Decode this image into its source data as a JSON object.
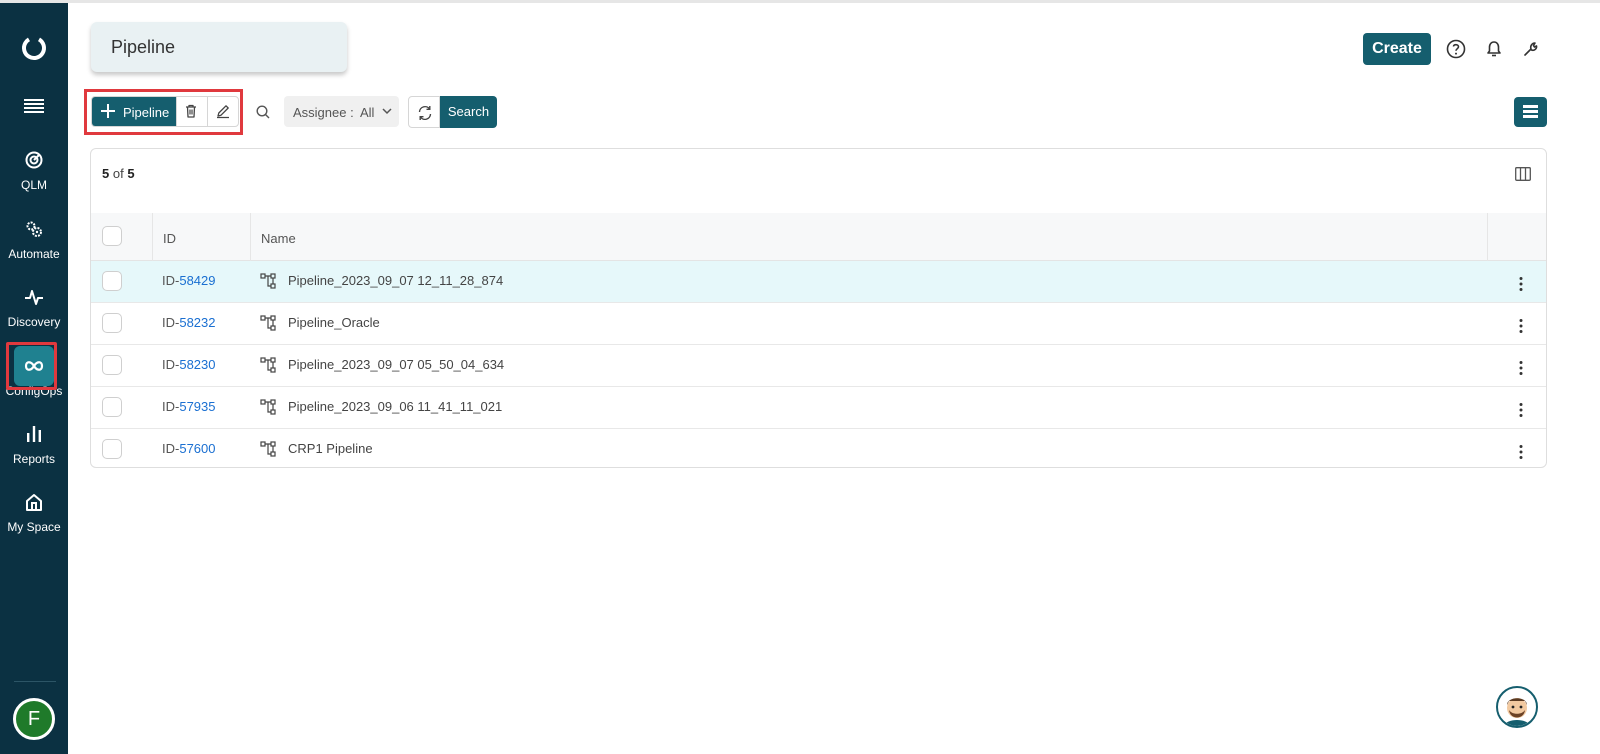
{
  "sidebar": {
    "items": [
      {
        "label": "QLM",
        "icon": "target-icon"
      },
      {
        "label": "Automate",
        "icon": "gears-icon"
      },
      {
        "label": "Discovery",
        "icon": "pulse-icon"
      },
      {
        "label": "ConfigOps",
        "icon": "infinity-icon"
      },
      {
        "label": "Reports",
        "icon": "bar-chart-icon"
      },
      {
        "label": "My Space",
        "icon": "home-icon"
      }
    ],
    "active": "ConfigOps",
    "avatar_initial": "F"
  },
  "header": {
    "title": "Pipeline",
    "create_label": "Create"
  },
  "toolbar": {
    "add_label": "Pipeline",
    "assignee_label": "Assignee :",
    "assignee_value": "All",
    "search_label": "Search"
  },
  "table": {
    "count_shown": "5",
    "count_of": "of",
    "count_total": "5",
    "columns": [
      "ID",
      "Name"
    ],
    "rows": [
      {
        "id_prefix": "ID-",
        "id_num": "58429",
        "name": "Pipeline_2023_09_07 12_11_28_874",
        "highlighted": true
      },
      {
        "id_prefix": "ID-",
        "id_num": "58232",
        "name": "Pipeline_Oracle",
        "highlighted": false
      },
      {
        "id_prefix": "ID-",
        "id_num": "58230",
        "name": "Pipeline_2023_09_07 05_50_04_634",
        "highlighted": false
      },
      {
        "id_prefix": "ID-",
        "id_num": "57935",
        "name": "Pipeline_2023_09_06 11_41_11_021",
        "highlighted": false
      },
      {
        "id_prefix": "ID-",
        "id_num": "57600",
        "name": "CRP1 Pipeline",
        "highlighted": false
      }
    ]
  },
  "colors": {
    "sidebar_bg": "#0b3142",
    "accent": "#155e6e",
    "active_item": "#1f8190",
    "link": "#1a6fd1",
    "highlight_row": "#e6f8fa",
    "annotation": "#e0393e"
  }
}
